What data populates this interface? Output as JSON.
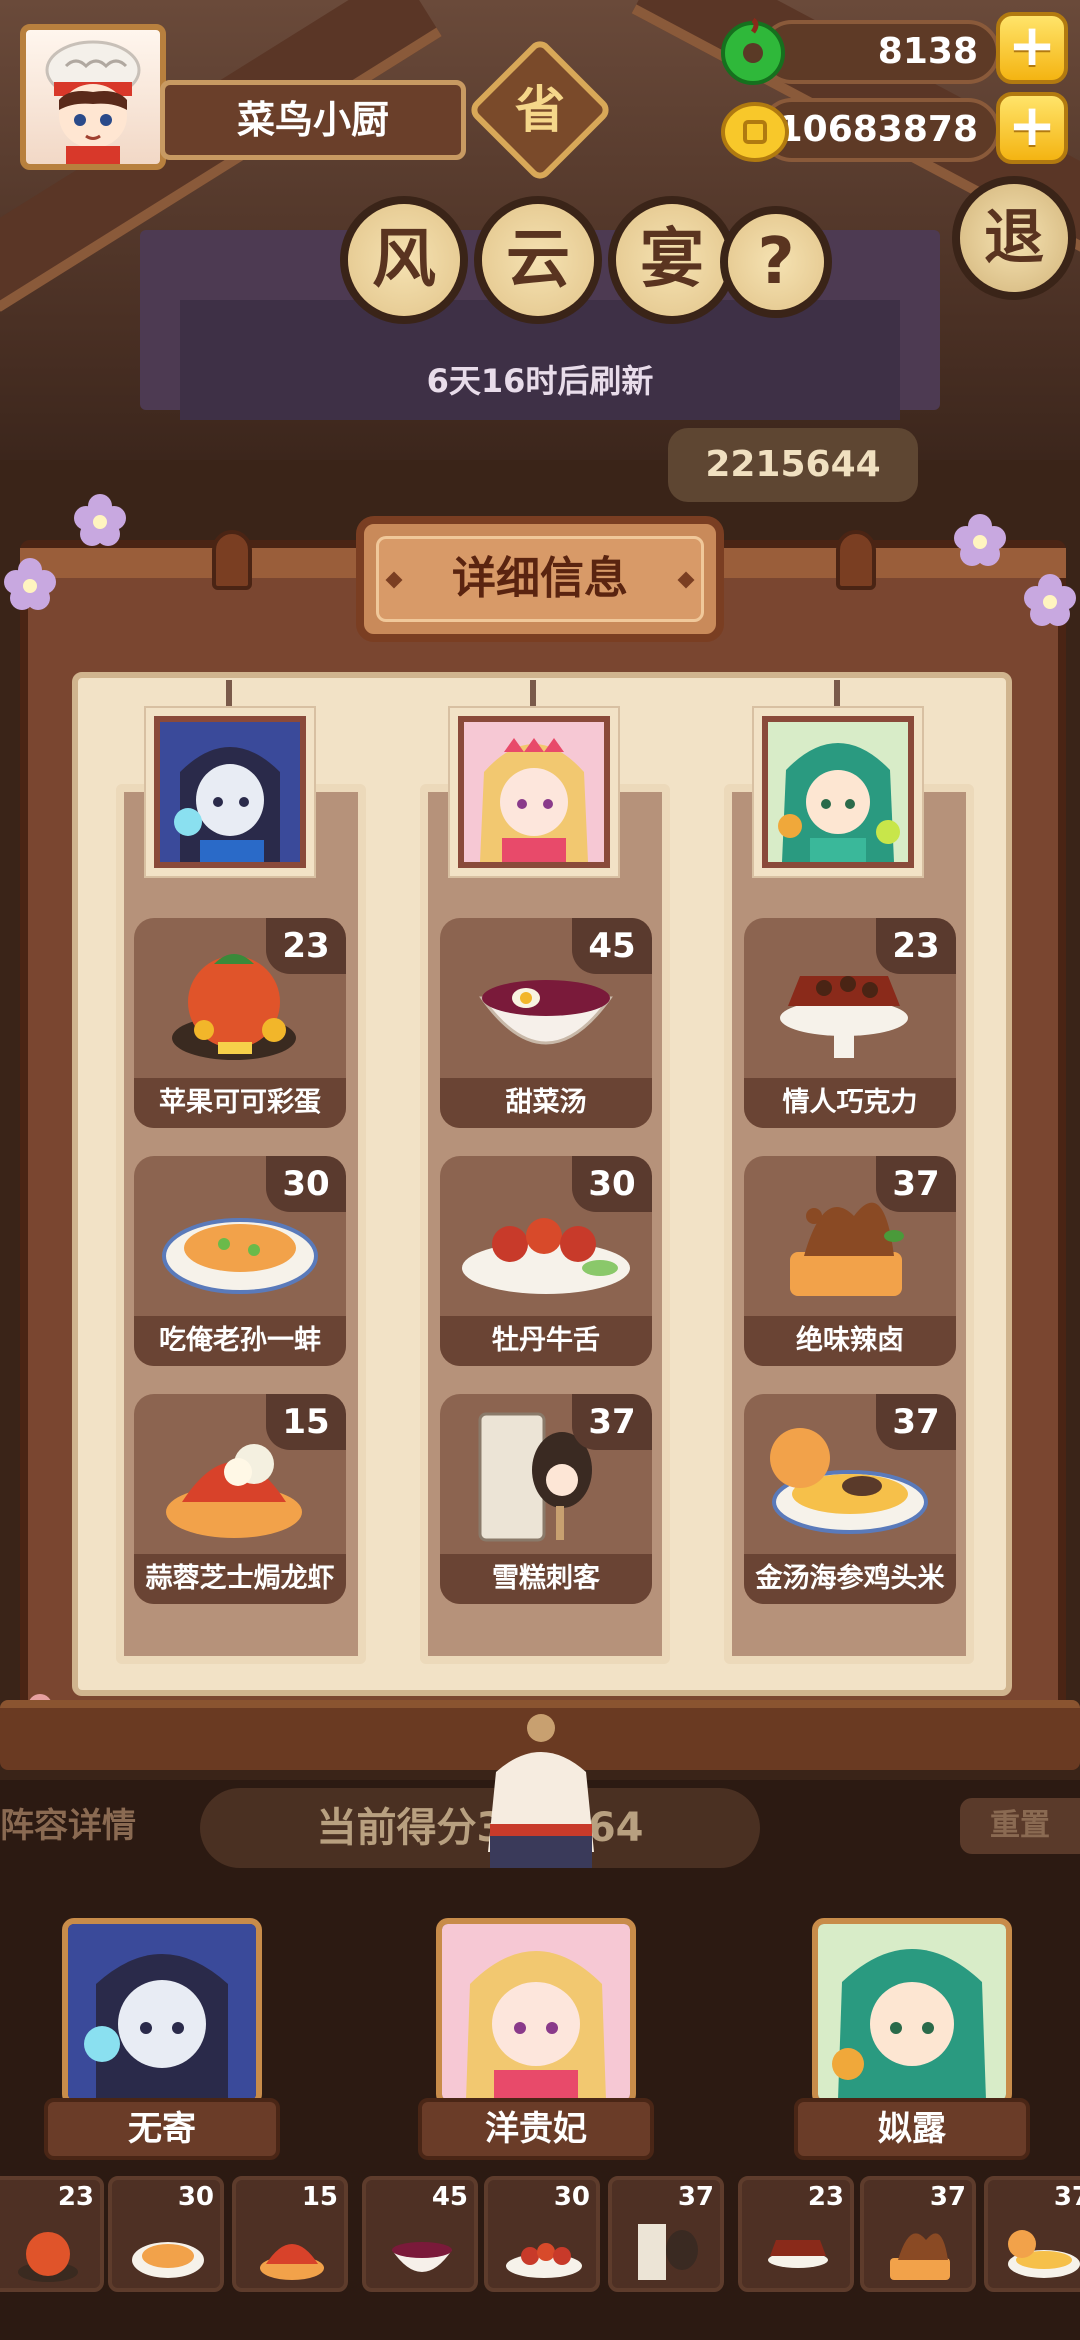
{
  "player": {
    "name": "菜鸟小厨",
    "province_badge": "省"
  },
  "currency": {
    "jade": "8138",
    "coins": "10683878",
    "add_symbol": "+"
  },
  "event": {
    "title_chars": [
      "风",
      "云",
      "宴"
    ],
    "help_symbol": "?",
    "exit_label": "退",
    "refresh_text": "6天16时后刷新",
    "top_score": "2215644"
  },
  "panel": {
    "title": "详细信息",
    "columns": [
      {
        "dishes": [
          {
            "name": "苹果可可彩蛋",
            "count": "23"
          },
          {
            "name": "吃俺老孙一蚌",
            "count": "30"
          },
          {
            "name": "蒜蓉芝士焗龙虾",
            "count": "15"
          }
        ]
      },
      {
        "dishes": [
          {
            "name": "甜菜汤",
            "count": "45"
          },
          {
            "name": "牡丹牛舌",
            "count": "30"
          },
          {
            "name": "雪糕刺客",
            "count": "37"
          }
        ]
      },
      {
        "dishes": [
          {
            "name": "情人巧克力",
            "count": "23"
          },
          {
            "name": "绝味辣卤",
            "count": "37"
          },
          {
            "name": "金汤海参鸡头米",
            "count": "37"
          }
        ]
      }
    ]
  },
  "bottom": {
    "lineup_label": "阵容详情",
    "current_score": "当前得分349564",
    "reset_label": "重置",
    "chefs": [
      "无寄",
      "洋贵妃",
      "姒露"
    ],
    "slots": [
      "23",
      "30",
      "15",
      "45",
      "30",
      "37",
      "23",
      "37",
      "37"
    ]
  },
  "colors": {
    "panel_brown": "#7a4630",
    "paper": "#f2e2c6",
    "gold_plus": "#f4b412",
    "jade_green": "#2fb83a"
  }
}
